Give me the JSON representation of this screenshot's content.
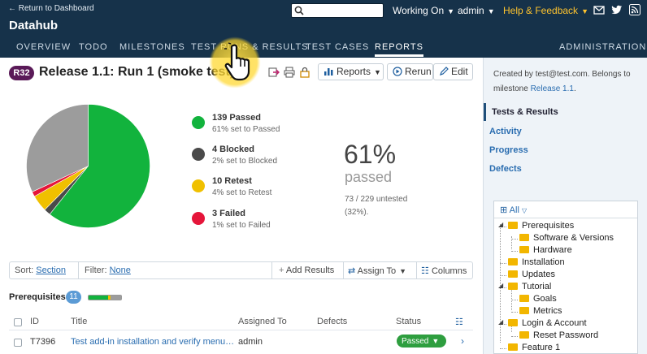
{
  "header": {
    "return_link": "← Return to Dashboard",
    "project": "Datahub",
    "search_placeholder": "",
    "menu": [
      {
        "label": "Working On"
      },
      {
        "label": "admin"
      },
      {
        "label": "Help & Feedback"
      }
    ],
    "icons": [
      "mail-icon",
      "twitter-icon",
      "rss-icon"
    ]
  },
  "nav": {
    "tabs": [
      {
        "label": "OVERVIEW"
      },
      {
        "label": "TODO"
      },
      {
        "label": "MILESTONES"
      },
      {
        "label": "TEST RUNS & RESULTS",
        "active": true
      },
      {
        "label": "TEST CASES"
      },
      {
        "label": "REPORTS"
      }
    ],
    "admin": "ADMINISTRATION"
  },
  "run": {
    "badge": "R32",
    "title": "Release 1.1: Run 1 (smoke test)"
  },
  "toolbar": {
    "reports": "Reports",
    "rerun": "Rerun",
    "edit": "Edit"
  },
  "chart_data": {
    "type": "pie",
    "categories": [
      "Passed",
      "Blocked",
      "Retest",
      "Failed",
      "Untested"
    ],
    "values": [
      139,
      4,
      10,
      3,
      73
    ],
    "colors": [
      "#12b33d",
      "#4a4a4a",
      "#f0c000",
      "#e5153a",
      "#9c9c9c"
    ],
    "title": ""
  },
  "legend": [
    {
      "name": "139 Passed",
      "sub": "61% set to Passed",
      "color": "#12b33d"
    },
    {
      "name": "4 Blocked",
      "sub": "2% set to Blocked",
      "color": "#4a4a4a"
    },
    {
      "name": "10 Retest",
      "sub": "4% set to Retest",
      "color": "#f0c000"
    },
    {
      "name": "3 Failed",
      "sub": "1% set to Failed",
      "color": "#e5153a"
    }
  ],
  "summary": {
    "percent": "61%",
    "label": "passed",
    "untested_line1": "73 / 229 untested",
    "untested_line2": "(32%)."
  },
  "filterbar": {
    "sort_label": "Sort:",
    "sort_value": "Section",
    "filter_label": "Filter:",
    "filter_value": "None",
    "add_results": "Add Results",
    "assign_to": "Assign To",
    "columns": "Columns"
  },
  "section": {
    "name": "Prerequisites",
    "count": "11"
  },
  "table": {
    "headers": [
      "ID",
      "Title",
      "Assigned To",
      "Defects",
      "Status"
    ],
    "rows": [
      {
        "id": "T7396",
        "title": "Test add-in installation and verify menu…",
        "assigned": "admin",
        "defects": "",
        "status": "Passed"
      }
    ]
  },
  "sidebar": {
    "created_prefix": "Created by test@test.com. Belongs to milestone ",
    "milestone": "Release 1.1",
    "created_suffix": ".",
    "nav": [
      {
        "label": "Tests & Results",
        "active": true
      },
      {
        "label": "Activity"
      },
      {
        "label": "Progress"
      },
      {
        "label": "Defects"
      }
    ]
  },
  "tree": {
    "filter": "All",
    "items": [
      {
        "label": "Prerequisites",
        "level": 0,
        "expanded": true
      },
      {
        "label": "Software & Versions",
        "level": 1
      },
      {
        "label": "Hardware",
        "level": 1
      },
      {
        "label": "Installation",
        "level": 0
      },
      {
        "label": "Updates",
        "level": 0
      },
      {
        "label": "Tutorial",
        "level": 0,
        "expanded": true
      },
      {
        "label": "Goals",
        "level": 1
      },
      {
        "label": "Metrics",
        "level": 1
      },
      {
        "label": "Login & Account",
        "level": 0,
        "expanded": true
      },
      {
        "label": "Reset Password",
        "level": 1
      },
      {
        "label": "Feature 1",
        "level": 0
      }
    ]
  }
}
